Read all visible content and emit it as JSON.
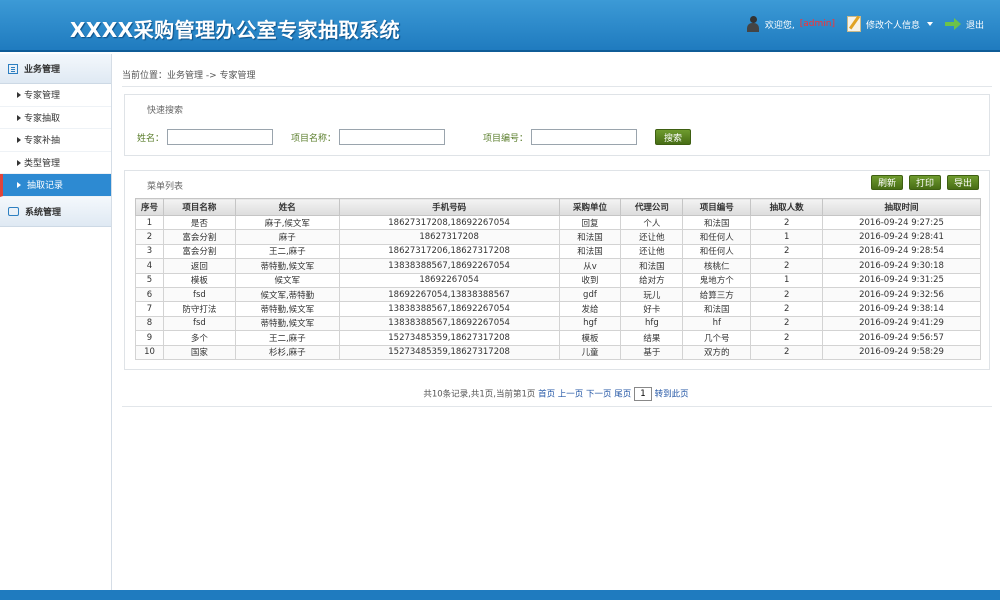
{
  "header": {
    "title": "XXXX采购管理办公室专家抽取系统",
    "welcome": "欢迎您,",
    "user": "[admin]",
    "edit_profile": "修改个人信息",
    "logout": "退出"
  },
  "sidebar": {
    "groups": [
      {
        "label": "业务管理",
        "items": [
          "专家管理",
          "专家抽取",
          "专家补抽",
          "类型管理",
          "抽取记录"
        ]
      },
      {
        "label": "系统管理",
        "items": []
      }
    ],
    "active_item": "抽取记录"
  },
  "breadcrumb": "当前位置：业务管理 -> 专家管理",
  "search": {
    "title": "快速搜索",
    "name_label": "姓名：",
    "project_name_label": "项目名称：",
    "project_code_label": "项目编号：",
    "search_button": "搜索"
  },
  "list": {
    "title": "菜单列表",
    "buttons": {
      "refresh": "刷新",
      "print": "打印",
      "export": "导出"
    },
    "columns": [
      "序号",
      "项目名称",
      "姓名",
      "手机号码",
      "采购单位",
      "代理公司",
      "项目编号",
      "抽取人数",
      "抽取时间"
    ],
    "rows": [
      [
        "1",
        "是否",
        "麻子,候文军",
        "18627317208,18692267054",
        "回复",
        "个人",
        "和法国",
        "2",
        "2016-09-24 9:27:25"
      ],
      [
        "2",
        "富会分割",
        "麻子",
        "18627317208",
        "和法国",
        "还让他",
        "和任何人",
        "1",
        "2016-09-24 9:28:41"
      ],
      [
        "3",
        "富会分割",
        "王二,麻子",
        "18627317206,18627317208",
        "和法国",
        "还让他",
        "和任何人",
        "2",
        "2016-09-24 9:28:54"
      ],
      [
        "4",
        "返回",
        "蒂特勤,候文军",
        "13838388567,18692267054",
        "从v",
        "和法国",
        "核桃仁",
        "2",
        "2016-09-24 9:30:18"
      ],
      [
        "5",
        "模板",
        "候文军",
        "18692267054",
        "收到",
        "给对方",
        "鬼地方个",
        "1",
        "2016-09-24 9:31:25"
      ],
      [
        "6",
        "fsd",
        "候文军,蒂特勤",
        "18692267054,13838388567",
        "gdf",
        "玩儿",
        "给算三方",
        "2",
        "2016-09-24 9:32:56"
      ],
      [
        "7",
        "防守打法",
        "蒂特勤,候文军",
        "13838388567,18692267054",
        "发给",
        "好卡",
        "和法国",
        "2",
        "2016-09-24 9:38:14"
      ],
      [
        "8",
        "fsd",
        "蒂特勤,候文军",
        "13838388567,18692267054",
        "hgf",
        "hfg",
        "hf",
        "2",
        "2016-09-24 9:41:29"
      ],
      [
        "9",
        "多个",
        "王二,麻子",
        "15273485359,18627317208",
        "模板",
        "结果",
        "几个号",
        "2",
        "2016-09-24 9:56:57"
      ],
      [
        "10",
        "国家",
        "杉杉,麻子",
        "15273485359,18627317208",
        "儿童",
        "基于",
        "双方的",
        "2",
        "2016-09-24 9:58:29"
      ]
    ]
  },
  "pager": {
    "summary": "共10条记录,共1页,当前第1页",
    "first": "首页",
    "prev": "上一页",
    "next": "下一页",
    "last": "尾页",
    "page_value": "1",
    "goto": "转到此页"
  }
}
